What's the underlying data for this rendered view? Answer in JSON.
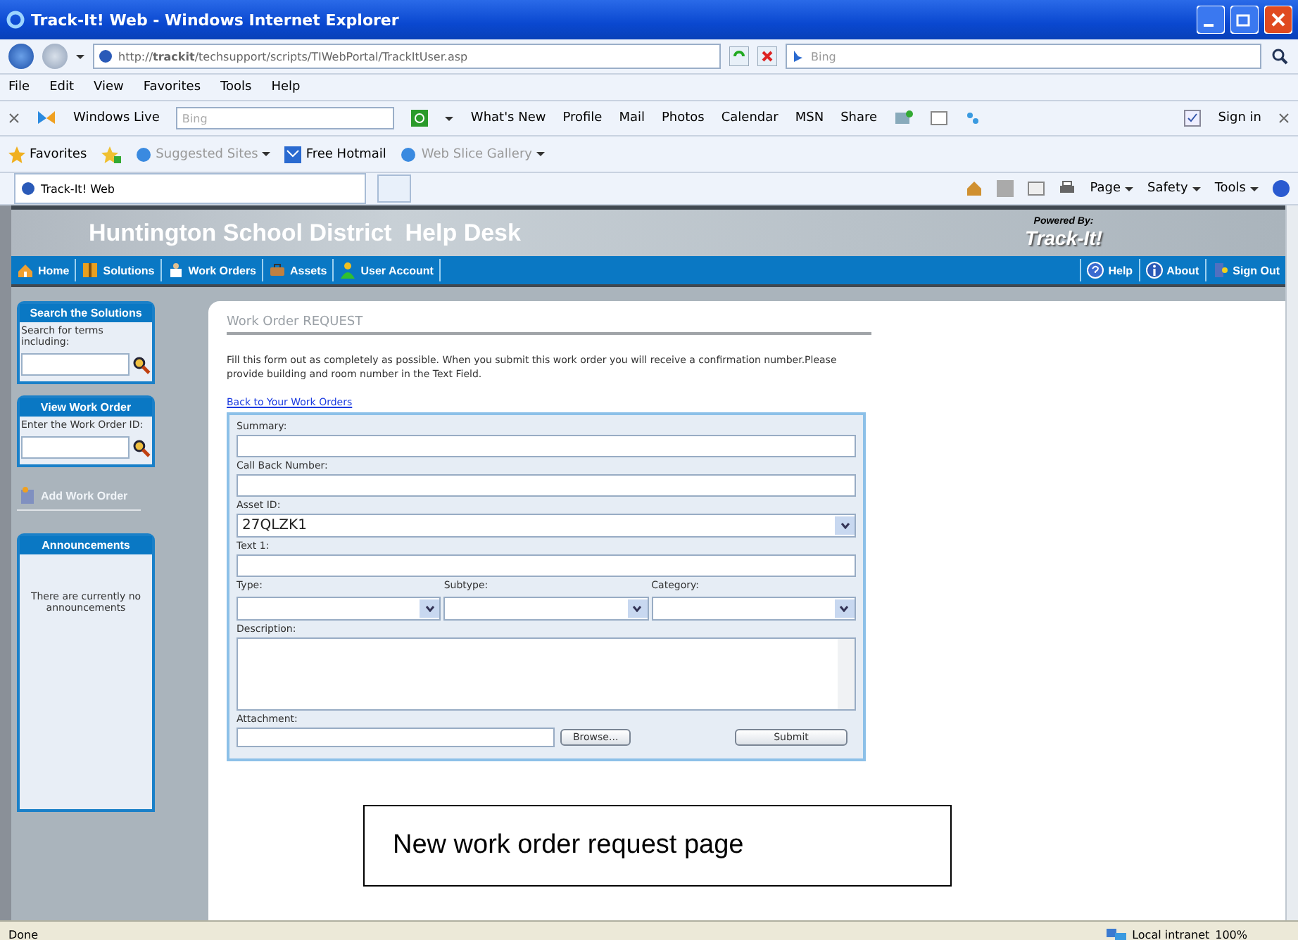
{
  "window": {
    "title": "Track-It! Web - Windows Internet Explorer"
  },
  "address_bar": {
    "url": "http://**trackit**/techsupport/scripts/TIWebPortal/TrackItUser.asp",
    "search_placeholder": "Bing"
  },
  "menu_bar": [
    "File",
    "Edit",
    "View",
    "Favorites",
    "Tools",
    "Help"
  ],
  "live_toolbar": {
    "brand": "Windows Live",
    "search_placeholder": "Bing",
    "links": [
      "What's New",
      "Profile",
      "Mail",
      "Photos",
      "Calendar",
      "MSN",
      "Share"
    ],
    "sign_in": "Sign in"
  },
  "favorites_bar": {
    "label": "Favorites",
    "links": [
      {
        "label": "Suggested Sites",
        "dimmed": true,
        "dropdown": true
      },
      {
        "label": "Free Hotmail",
        "dimmed": false,
        "dropdown": false
      },
      {
        "label": "Web Slice Gallery",
        "dimmed": true,
        "dropdown": true
      }
    ]
  },
  "tabs": [
    {
      "label": "Track-It! Web",
      "selected": true
    }
  ],
  "command_bar": [
    "Page",
    "Safety",
    "Tools"
  ],
  "page": {
    "header_title": "Huntington School District  Help Desk",
    "powered_by": "Powered By:",
    "logo": "Track-It!",
    "nav_left": [
      "Home",
      "Solutions",
      "Work Orders",
      "Assets",
      "User Account"
    ],
    "nav_right": [
      "Help",
      "About",
      "Sign Out"
    ],
    "sidebar": {
      "search_panel": {
        "title": "Search the Solutions",
        "label": "Search for terms including:"
      },
      "view_panel": {
        "title": "View Work Order",
        "label": "Enter the Work Order ID:"
      },
      "add_link": "Add Work Order",
      "announcements": {
        "title": "Announcements",
        "text": "There are currently no announcements"
      }
    },
    "form": {
      "title": "Work Order REQUEST",
      "intro": "Fill this form out as completely as possible. When you submit this work order you will receive a confirmation number.Please provide building and room number in the Text Field.",
      "back_link": "Back to Your Work Orders",
      "fields": [
        {
          "kind": "text",
          "label": "Summary:"
        },
        {
          "kind": "text",
          "label": "Call Back Number:"
        },
        {
          "kind": "select",
          "label": "Asset ID:",
          "value": "27QLZK1"
        },
        {
          "kind": "text",
          "label": "Text 1:"
        },
        {
          "kind": "selects",
          "items": [
            {
              "label": "Type:"
            },
            {
              "label": "Subtype:"
            },
            {
              "label": "Category:"
            }
          ]
        },
        {
          "kind": "textarea",
          "label": "Description:"
        },
        {
          "kind": "file",
          "label": "Attachment:",
          "browse": "Browse...",
          "submit": "Submit"
        }
      ]
    }
  },
  "caption": "New work order request page",
  "status_bar": {
    "text": "Done",
    "zone": "Local intranet",
    "zoom": "100%"
  }
}
